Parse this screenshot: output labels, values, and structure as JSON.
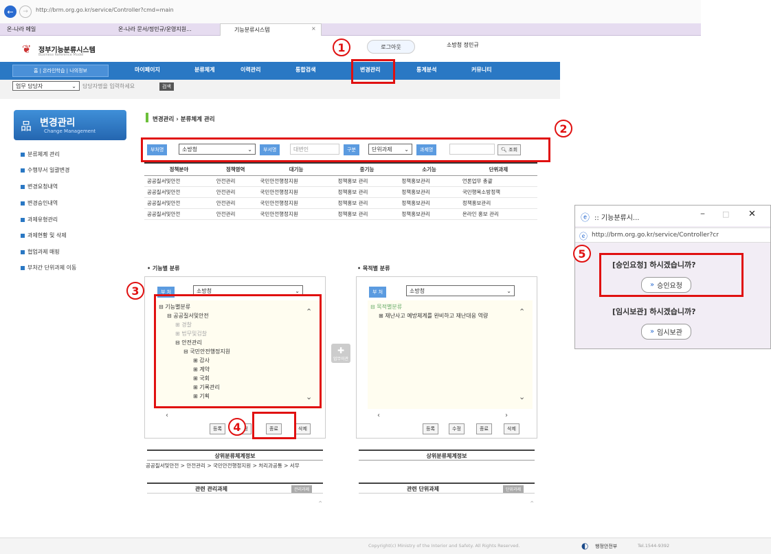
{
  "browser": {
    "url": "http://brm.org.go.kr/service/Controller?cmd=main",
    "favorites": [
      "온-나라 메일",
      "온-나라 문서/정민규/운영지원...",
      "기능분류시스템"
    ],
    "tab_close": "×"
  },
  "site": {
    "logo_title": "정부기능분류시스템",
    "logo_sub": "Business Reference Model",
    "logout": "로그아웃",
    "user": "소방청 정민규"
  },
  "gnb": {
    "home": "홈 | 온라인학습 | 나의정보",
    "items": [
      "마이페이지",
      "분류체계",
      "이력관리",
      "통합검색",
      "변경관리",
      "통계분석",
      "커뮤니티"
    ]
  },
  "topsearch": {
    "select": "업무 담당자",
    "placeholder": "담당자명을 입력하세요",
    "button": "검색"
  },
  "side": {
    "title": "변경관리",
    "subtitle": "Change Management",
    "items": [
      "분류체계 관리",
      "수행부서 일괄변경",
      "변경요청내역",
      "변경승인내역",
      "과제유형관리",
      "과제현황 및 삭제",
      "협업과제 매핑",
      "부처간 단위과제 이동"
    ]
  },
  "breadcrumb": "변경관리 › 분류체계 관리",
  "filter": {
    "dept_label": "부처명",
    "dept_value": "소방청",
    "bureau_label": "부서명",
    "bureau_value": "대변인",
    "type_label": "구분",
    "type_value": "단위과제",
    "task_label": "과제명",
    "search": "조회"
  },
  "table": {
    "headers": [
      "정책분야",
      "정책영역",
      "대기능",
      "중기능",
      "소기능",
      "단위과제"
    ],
    "rows": [
      [
        "공공질서및안전",
        "안전관리",
        "국민안전행정지원",
        "정책홍보 관리",
        "정책홍보관리",
        "언론업무 총괄"
      ],
      [
        "공공질서및안전",
        "안전관리",
        "국민안전행정지원",
        "정책홍보 관리",
        "정책홍보관리",
        "국민행복소방정책"
      ],
      [
        "공공질서및안전",
        "안전관리",
        "국민안전행정지원",
        "정책홍보 관리",
        "정책홍보관리",
        "정책홍보관리"
      ],
      [
        "공공질서및안전",
        "안전관리",
        "국민안전행정지원",
        "정책홍보 관리",
        "정책홍보관리",
        "온라인 홍보 관리"
      ]
    ]
  },
  "func": {
    "title": "• 기능별 분류",
    "dept_label": "부 처",
    "dept_value": "소방청",
    "tree": [
      "기능별분류",
      "공공질서및안전",
      "경찰",
      "법무및검찰",
      "안전관리",
      "국민안전행정지원",
      "감사",
      "계약",
      "국회",
      "기록관리",
      "기획"
    ],
    "buttons": [
      "등록",
      "수정",
      "종료",
      "삭제"
    ],
    "upper_title": "상위분류체계정보",
    "upper_text": "공공질서및안전 > 안전관리 > 국민안전행정지원 > 처리과공통 > 서무",
    "related_title": "관련 관리과제",
    "related_btn": "관리과제"
  },
  "purpose": {
    "title": "• 목적별 분류",
    "dept_label": "부 처",
    "dept_value": "소방청",
    "tree": [
      "목적별분류",
      "재난사고 예방체계를 완비하고 재난대응 역량"
    ],
    "buttons": [
      "등록",
      "수정",
      "종료",
      "삭제"
    ],
    "upper_title": "상위분류체계정보",
    "related_title": "관련 단위과제",
    "related_btn": "단위과제"
  },
  "move_btn": "업무이관",
  "annotations": [
    "1",
    "2",
    "3",
    "4",
    "5"
  ],
  "popup": {
    "title": ":: 기능분류시...",
    "url": "http://brm.org.go.kr/service/Controller?cr",
    "q1": "[승인요청] 하시겠습니까?",
    "b1": "승인요청",
    "q2": "[임시보관] 하시겠습니까?",
    "b2": "임시보관"
  },
  "footer": {
    "copyright": "Copyright(c) Ministry of the Interior and Safety. All Rights Reserved.",
    "org": "행정안전부",
    "tel": "Tel.1544-9392"
  },
  "colors": {
    "nav": "#2a78c4",
    "highlight": "#e01010",
    "popup_bg": "#f2edf5"
  }
}
